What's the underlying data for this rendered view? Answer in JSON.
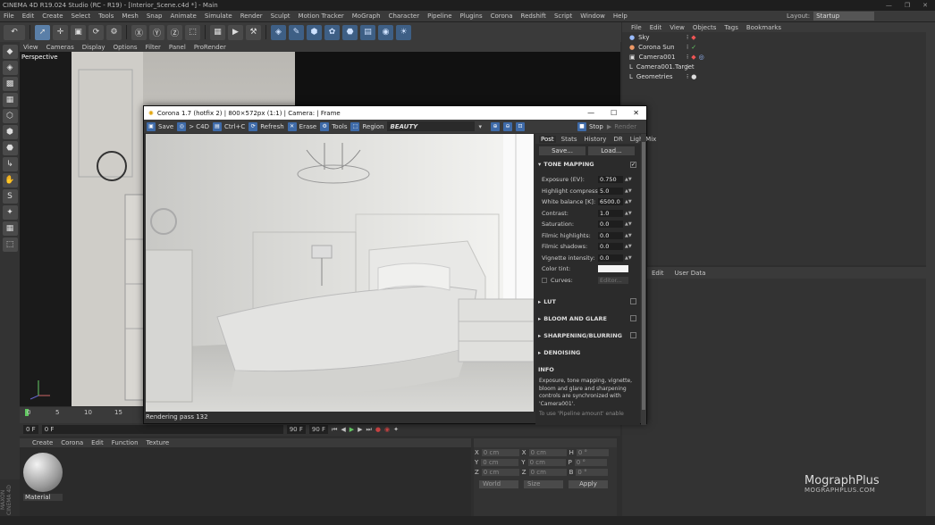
{
  "window_title": "CINEMA 4D R19.024 Studio (RC - R19) - [Interior_Scene.c4d *] - Main",
  "menu": [
    "File",
    "Edit",
    "Create",
    "Select",
    "Tools",
    "Mesh",
    "Snap",
    "Animate",
    "Simulate",
    "Render",
    "Sculpt",
    "Motion Tracker",
    "MoGraph",
    "Character",
    "Pipeline",
    "Plugins",
    "Corona",
    "Redshift",
    "Script",
    "Window",
    "Help"
  ],
  "layout": {
    "label": "Layout:",
    "value": "Startup"
  },
  "viewport": {
    "menu": [
      "View",
      "Cameras",
      "Display",
      "Options",
      "Filter",
      "Panel",
      "ProRender"
    ],
    "label": "Perspective"
  },
  "timeline": {
    "ticks": [
      "0",
      "5",
      "10",
      "15"
    ],
    "start": "0 F",
    "current": "0 F",
    "end": "90 F",
    "end2": "90 F"
  },
  "objects": {
    "menu": [
      "File",
      "Edit",
      "View",
      "Objects",
      "Tags",
      "Bookmarks"
    ],
    "items": [
      {
        "name": "Sky"
      },
      {
        "name": "Corona Sun"
      },
      {
        "name": "Camera001"
      },
      {
        "name": "Camera001.Target"
      },
      {
        "name": "Geometries"
      }
    ]
  },
  "attributes": {
    "menu": [
      "Edit",
      "User Data"
    ]
  },
  "material": {
    "menu": [
      "Create",
      "Corona",
      "Edit",
      "Function",
      "Texture"
    ],
    "name": "Material"
  },
  "coords": {
    "rows": [
      {
        "a": "X",
        "av": "0 cm",
        "b": "X",
        "bv": "0 cm",
        "c": "H",
        "cv": "0 °"
      },
      {
        "a": "Y",
        "av": "0 cm",
        "b": "Y",
        "bv": "0 cm",
        "c": "P",
        "cv": "0 °"
      },
      {
        "a": "Z",
        "av": "0 cm",
        "b": "Z",
        "bv": "0 cm",
        "c": "B",
        "cv": "0 °"
      }
    ],
    "mode1": "World",
    "mode2": "Size",
    "apply": "Apply"
  },
  "watermark": {
    "line1": "MographPlus",
    "line2": "MOGRAPHPLUS.COM"
  },
  "maxon": "MAXON CINEMA 4D",
  "corona": {
    "title": "Corona 1.7 (hotfix 2) | 800×572px (1:1) | Camera: | Frame",
    "toolbar": {
      "save": "Save",
      "c4d": "> C4D",
      "ctrlc": "Ctrl+C",
      "refresh": "Refresh",
      "erase": "Erase",
      "tools": "Tools",
      "region": "Region",
      "pass": "BEAUTY",
      "stop": "Stop",
      "render": "Render"
    },
    "status": "Rendering pass 132",
    "tabs": [
      "Post",
      "Stats",
      "History",
      "DR",
      "LightMix"
    ],
    "save_btn": "Save...",
    "load_btn": "Load...",
    "tone_mapping": "TONE MAPPING",
    "params": [
      {
        "label": "Exposure (EV):",
        "value": "0.750"
      },
      {
        "label": "Highlight compress:",
        "value": "5.0"
      },
      {
        "label": "White balance [K]:",
        "value": "6500.0"
      },
      {
        "label": "Contrast:",
        "value": "1.0"
      },
      {
        "label": "Saturation:",
        "value": "0.0"
      },
      {
        "label": "Filmic highlights:",
        "value": "0.0"
      },
      {
        "label": "Filmic shadows:",
        "value": "0.0"
      },
      {
        "label": "Vignette intensity:",
        "value": "0.0"
      }
    ],
    "color_tint": "Color tint:",
    "curves": "Curves:",
    "curves_btn": "Editor...",
    "sections": [
      "LUT",
      "BLOOM AND GLARE",
      "SHARPENING/BLURRING",
      "DENOISING"
    ],
    "info_title": "INFO",
    "info_text": "Exposure, tone mapping, vignette, bloom and glare and sharpening controls are synchronized with 'Camera001'.",
    "info_text2": "To use 'Pipeline amount' enable"
  }
}
